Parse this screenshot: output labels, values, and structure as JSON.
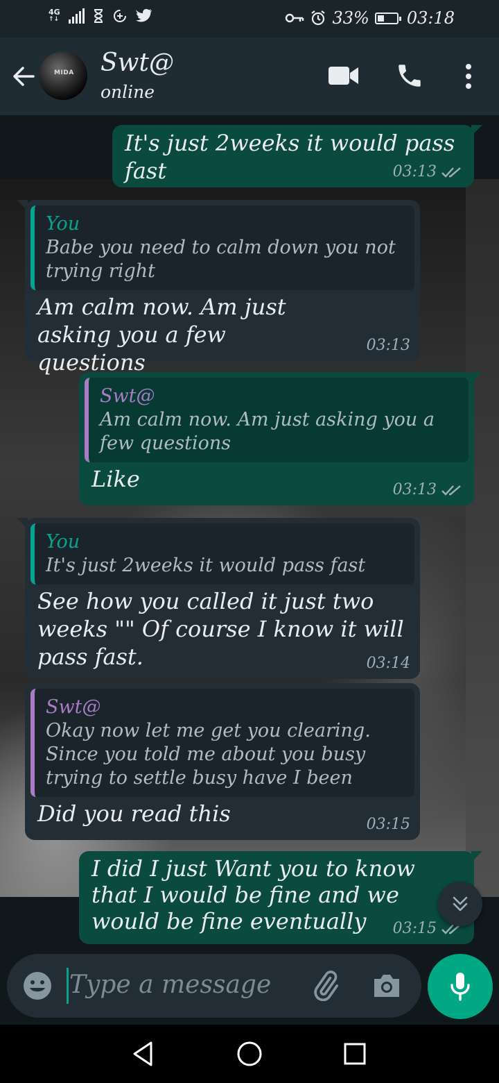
{
  "status_bar": {
    "network": "4G",
    "battery": "33%",
    "battery_level": 0.33,
    "time": "03:18",
    "icons": [
      "signal-icon",
      "hourglass-icon",
      "data-saver-icon",
      "twitter-icon",
      "key-icon",
      "alarm-icon",
      "battery-icon"
    ]
  },
  "header": {
    "contact_name": "Swt@",
    "status": "online",
    "avatar_text": "MIDA",
    "icons": [
      "back-arrow-icon",
      "video-call-icon",
      "phone-icon",
      "more-vert-icon"
    ]
  },
  "messages": [
    {
      "direction": "out",
      "text": "It's just 2weeks it would pass fast",
      "time": "03:13",
      "read": true
    },
    {
      "direction": "in",
      "quote_author": "You",
      "quote_text": "Babe you need to calm down you not trying right",
      "text": "Am calm now. Am just asking you a few questions",
      "time": "03:13"
    },
    {
      "direction": "out",
      "quote_author": "Swt@",
      "quote_text": "Am calm now. Am just asking you a few questions",
      "text": "Like",
      "time": "03:13",
      "read": true
    },
    {
      "direction": "in",
      "quote_author": "You",
      "quote_text": "It's just 2weeks it would pass fast",
      "text": "See how you called it just two weeks \"\" Of course I know it will pass  fast.",
      "time": "03:14"
    },
    {
      "direction": "in",
      "quote_author": "Swt@",
      "quote_text": "Okay now let me get you clearing. Since you told me about you busy trying to settle busy have I been distracting you...",
      "text": "Did you read this",
      "time": "03:15"
    },
    {
      "direction": "out",
      "text": "I did I just Want you to know that I would be fine and we would be fine eventually",
      "time": "03:15",
      "read": true
    }
  ],
  "composer": {
    "placeholder": "Type a message",
    "icons": [
      "emoji-icon",
      "attach-icon",
      "camera-icon",
      "mic-icon"
    ]
  },
  "colors": {
    "outgoing_bubble": "#0a4a3f",
    "incoming_bubble": "#232d36",
    "accent": "#00a884",
    "quote_you": "#06a48e",
    "quote_contact": "#a97cc6",
    "header_bg": "#1f2c34"
  }
}
